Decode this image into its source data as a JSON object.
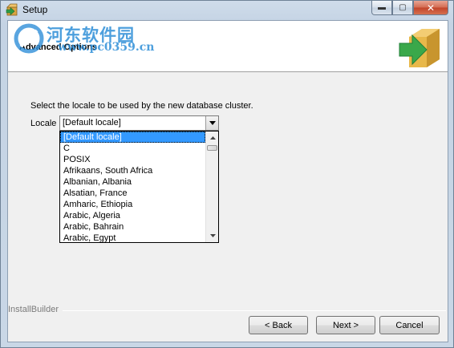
{
  "window": {
    "title": "Setup",
    "minimize": "▬",
    "maximize": "▢",
    "close": "✕"
  },
  "watermark": {
    "text": "河东软件园",
    "url": "www.pc0359.cn"
  },
  "header": {
    "title": "Advanced Options"
  },
  "main": {
    "prompt": "Select the locale to be used by the new database cluster.",
    "locale_label": "Locale",
    "locale_value": "[Default locale]",
    "locale_options": [
      "[Default locale]",
      "C",
      "POSIX",
      "Afrikaans, South Africa",
      "Albanian, Albania",
      "Alsatian, France",
      "Amharic, Ethiopia",
      "Arabic, Algeria",
      "Arabic, Bahrain",
      "Arabic, Egypt"
    ],
    "selected_index": 0
  },
  "footer": {
    "brand": "InstallBuilder",
    "back_label": "< Back",
    "next_label": "Next >",
    "cancel_label": "Cancel"
  },
  "colors": {
    "selection": "#3399ff",
    "logo_green": "#3aa84a",
    "logo_box": "#e8b84a",
    "watermark": "#2f8fd8"
  }
}
